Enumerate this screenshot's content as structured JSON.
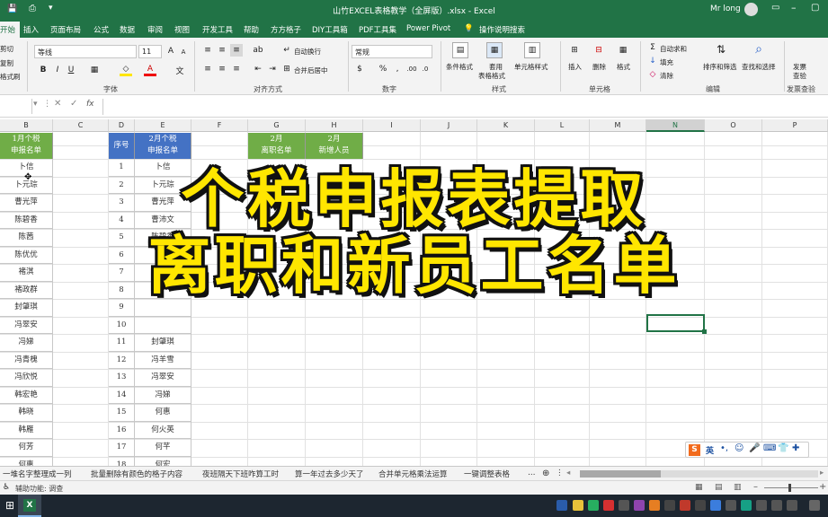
{
  "window": {
    "title": "山竹EXCEL表格教学（全屏版）.xlsx  -  Excel",
    "user": "Mr long"
  },
  "tabs": [
    "开始",
    "插入",
    "页面布局",
    "公式",
    "数据",
    "审阅",
    "视图",
    "开发工具",
    "帮助",
    "方方格子",
    "DIY工具箱",
    "PDF工具集",
    "Power Pivot"
  ],
  "tell_me": "操作说明搜索",
  "ribbon": {
    "clipboard": {
      "cut": "剪切",
      "copy": "复制",
      "painter": "格式刷"
    },
    "font": {
      "name": "等线",
      "size": "11",
      "section": "字体"
    },
    "alignment": {
      "wrap": "自动换行",
      "merge": "合并后居中",
      "section": "对齐方式"
    },
    "number": {
      "format": "常规",
      "section": "数字"
    },
    "styles": {
      "cond": "条件格式",
      "table1": "套用",
      "table2": "表格格式",
      "cell": "单元格样式",
      "section": "样式"
    },
    "cells": {
      "insert": "插入",
      "delete": "删除",
      "format": "格式",
      "section": "单元格"
    },
    "editing": {
      "autosum": "自动求和",
      "fill": "填充",
      "clear": "清除",
      "sort": "排序和筛选",
      "find": "查找和选择",
      "section": "编辑"
    },
    "publish": {
      "label1": "发票",
      "label2": "查验",
      "section": "发票查验"
    }
  },
  "formula_bar": {
    "fx": "fx"
  },
  "columns": [
    "B",
    "C",
    "D",
    "E",
    "F",
    "G",
    "H",
    "I",
    "J",
    "K",
    "L",
    "M",
    "N",
    "O",
    "P"
  ],
  "headers": {
    "b1": "1月个税",
    "b2": "申报名单",
    "d": "序号",
    "e1": "2月个税",
    "e2": "申报名单",
    "g1": "2月",
    "g2": "离职名单",
    "h1": "2月",
    "h2": "新增人员"
  },
  "col_b": [
    "卜信",
    "卜元琮",
    "曹光萍",
    "陈碧香",
    "陈茜",
    "陈优优",
    "褚淇",
    "褚政群",
    "封肇琪",
    "冯翠安",
    "冯娣",
    "冯青槐",
    "冯欣悦",
    "韩宏艳",
    "韩晓",
    "韩雁",
    "何芳",
    "何惠"
  ],
  "col_d": [
    "1",
    "2",
    "3",
    "4",
    "5",
    "6",
    "7",
    "8",
    "9",
    "10",
    "11",
    "12",
    "13",
    "14",
    "15",
    "16",
    "17",
    "18"
  ],
  "col_e": [
    "卜信",
    "卜元琮",
    "曹光萍",
    "曹沛文",
    "陈碧香",
    "陈茜",
    "",
    "",
    "",
    "",
    "封肇琪",
    "冯羊雪",
    "冯翠安",
    "冯娣",
    "何惠",
    "何火英",
    "何芊",
    "何宏"
  ],
  "overlay": {
    "line1": "个税申报表提取",
    "line2": "离职和新员工名单"
  },
  "sheet_tabs": [
    "一堆名字整理成一列",
    "批量删除有颜色的格子内容",
    "夜班隔天下班咋算工时",
    "算一年过去多少天了",
    "合并单元格乘法运算",
    "一键调整表格"
  ],
  "status": {
    "text": "辅助功能: 调查"
  },
  "ime": {
    "label": "英"
  },
  "colors": {
    "excel_green": "#217346",
    "header_green": "#70ad47",
    "header_blue": "#4472c4",
    "overlay_yellow": "#ffe600"
  }
}
